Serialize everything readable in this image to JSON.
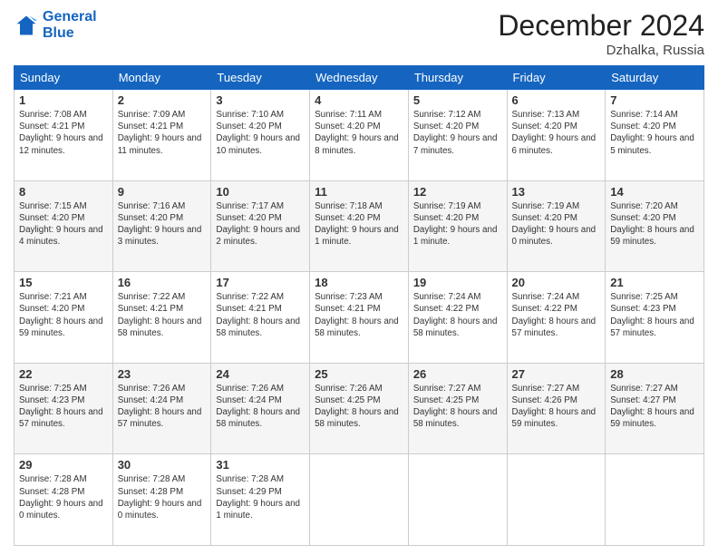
{
  "header": {
    "logo_line1": "General",
    "logo_line2": "Blue",
    "month": "December 2024",
    "location": "Dzhalka, Russia"
  },
  "weekdays": [
    "Sunday",
    "Monday",
    "Tuesday",
    "Wednesday",
    "Thursday",
    "Friday",
    "Saturday"
  ],
  "weeks": [
    [
      {
        "day": "1",
        "rise": "Sunrise: 7:08 AM",
        "set": "Sunset: 4:21 PM",
        "day_text": "Daylight: 9 hours and 12 minutes."
      },
      {
        "day": "2",
        "rise": "Sunrise: 7:09 AM",
        "set": "Sunset: 4:21 PM",
        "day_text": "Daylight: 9 hours and 11 minutes."
      },
      {
        "day": "3",
        "rise": "Sunrise: 7:10 AM",
        "set": "Sunset: 4:20 PM",
        "day_text": "Daylight: 9 hours and 10 minutes."
      },
      {
        "day": "4",
        "rise": "Sunrise: 7:11 AM",
        "set": "Sunset: 4:20 PM",
        "day_text": "Daylight: 9 hours and 8 minutes."
      },
      {
        "day": "5",
        "rise": "Sunrise: 7:12 AM",
        "set": "Sunset: 4:20 PM",
        "day_text": "Daylight: 9 hours and 7 minutes."
      },
      {
        "day": "6",
        "rise": "Sunrise: 7:13 AM",
        "set": "Sunset: 4:20 PM",
        "day_text": "Daylight: 9 hours and 6 minutes."
      },
      {
        "day": "7",
        "rise": "Sunrise: 7:14 AM",
        "set": "Sunset: 4:20 PM",
        "day_text": "Daylight: 9 hours and 5 minutes."
      }
    ],
    [
      {
        "day": "8",
        "rise": "Sunrise: 7:15 AM",
        "set": "Sunset: 4:20 PM",
        "day_text": "Daylight: 9 hours and 4 minutes."
      },
      {
        "day": "9",
        "rise": "Sunrise: 7:16 AM",
        "set": "Sunset: 4:20 PM",
        "day_text": "Daylight: 9 hours and 3 minutes."
      },
      {
        "day": "10",
        "rise": "Sunrise: 7:17 AM",
        "set": "Sunset: 4:20 PM",
        "day_text": "Daylight: 9 hours and 2 minutes."
      },
      {
        "day": "11",
        "rise": "Sunrise: 7:18 AM",
        "set": "Sunset: 4:20 PM",
        "day_text": "Daylight: 9 hours and 1 minute."
      },
      {
        "day": "12",
        "rise": "Sunrise: 7:19 AM",
        "set": "Sunset: 4:20 PM",
        "day_text": "Daylight: 9 hours and 1 minute."
      },
      {
        "day": "13",
        "rise": "Sunrise: 7:19 AM",
        "set": "Sunset: 4:20 PM",
        "day_text": "Daylight: 9 hours and 0 minutes."
      },
      {
        "day": "14",
        "rise": "Sunrise: 7:20 AM",
        "set": "Sunset: 4:20 PM",
        "day_text": "Daylight: 8 hours and 59 minutes."
      }
    ],
    [
      {
        "day": "15",
        "rise": "Sunrise: 7:21 AM",
        "set": "Sunset: 4:20 PM",
        "day_text": "Daylight: 8 hours and 59 minutes."
      },
      {
        "day": "16",
        "rise": "Sunrise: 7:22 AM",
        "set": "Sunset: 4:21 PM",
        "day_text": "Daylight: 8 hours and 58 minutes."
      },
      {
        "day": "17",
        "rise": "Sunrise: 7:22 AM",
        "set": "Sunset: 4:21 PM",
        "day_text": "Daylight: 8 hours and 58 minutes."
      },
      {
        "day": "18",
        "rise": "Sunrise: 7:23 AM",
        "set": "Sunset: 4:21 PM",
        "day_text": "Daylight: 8 hours and 58 minutes."
      },
      {
        "day": "19",
        "rise": "Sunrise: 7:24 AM",
        "set": "Sunset: 4:22 PM",
        "day_text": "Daylight: 8 hours and 58 minutes."
      },
      {
        "day": "20",
        "rise": "Sunrise: 7:24 AM",
        "set": "Sunset: 4:22 PM",
        "day_text": "Daylight: 8 hours and 57 minutes."
      },
      {
        "day": "21",
        "rise": "Sunrise: 7:25 AM",
        "set": "Sunset: 4:23 PM",
        "day_text": "Daylight: 8 hours and 57 minutes."
      }
    ],
    [
      {
        "day": "22",
        "rise": "Sunrise: 7:25 AM",
        "set": "Sunset: 4:23 PM",
        "day_text": "Daylight: 8 hours and 57 minutes."
      },
      {
        "day": "23",
        "rise": "Sunrise: 7:26 AM",
        "set": "Sunset: 4:24 PM",
        "day_text": "Daylight: 8 hours and 57 minutes."
      },
      {
        "day": "24",
        "rise": "Sunrise: 7:26 AM",
        "set": "Sunset: 4:24 PM",
        "day_text": "Daylight: 8 hours and 58 minutes."
      },
      {
        "day": "25",
        "rise": "Sunrise: 7:26 AM",
        "set": "Sunset: 4:25 PM",
        "day_text": "Daylight: 8 hours and 58 minutes."
      },
      {
        "day": "26",
        "rise": "Sunrise: 7:27 AM",
        "set": "Sunset: 4:25 PM",
        "day_text": "Daylight: 8 hours and 58 minutes."
      },
      {
        "day": "27",
        "rise": "Sunrise: 7:27 AM",
        "set": "Sunset: 4:26 PM",
        "day_text": "Daylight: 8 hours and 59 minutes."
      },
      {
        "day": "28",
        "rise": "Sunrise: 7:27 AM",
        "set": "Sunset: 4:27 PM",
        "day_text": "Daylight: 8 hours and 59 minutes."
      }
    ],
    [
      {
        "day": "29",
        "rise": "Sunrise: 7:28 AM",
        "set": "Sunset: 4:28 PM",
        "day_text": "Daylight: 9 hours and 0 minutes."
      },
      {
        "day": "30",
        "rise": "Sunrise: 7:28 AM",
        "set": "Sunset: 4:28 PM",
        "day_text": "Daylight: 9 hours and 0 minutes."
      },
      {
        "day": "31",
        "rise": "Sunrise: 7:28 AM",
        "set": "Sunset: 4:29 PM",
        "day_text": "Daylight: 9 hours and 1 minute."
      },
      null,
      null,
      null,
      null
    ]
  ]
}
